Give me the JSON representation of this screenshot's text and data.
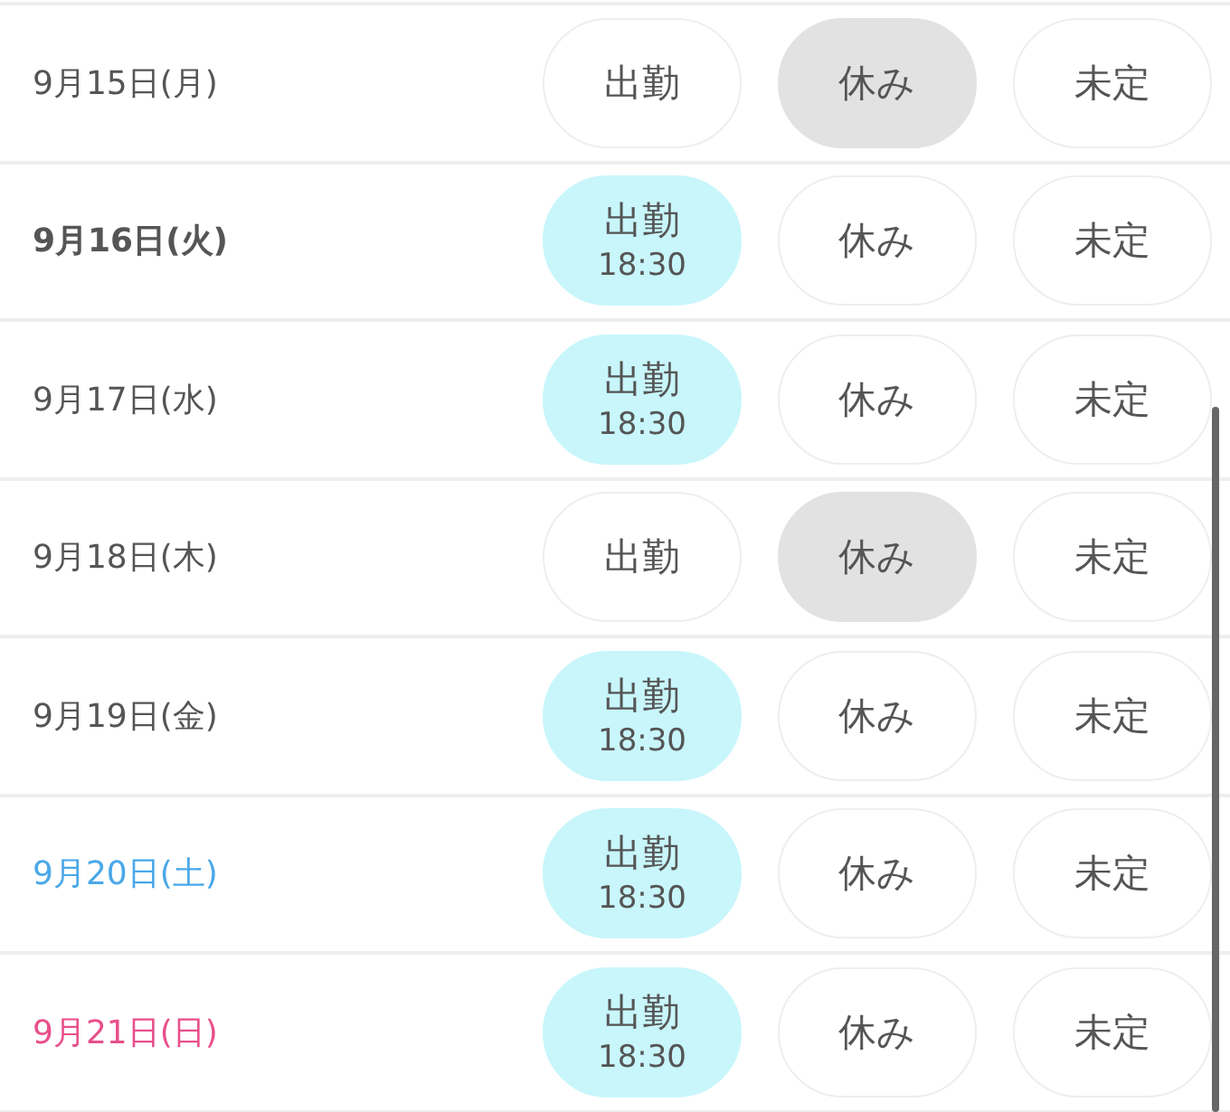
{
  "days": [
    {
      "date": "9月15日(月)",
      "color": "#555555",
      "emphasized": false,
      "options": [
        {
          "label": "出勤",
          "selected": false
        },
        {
          "label": "休み",
          "selected": true
        },
        {
          "label": "未定",
          "selected": false
        }
      ]
    },
    {
      "date": "9月16日(火)",
      "color": "#555555",
      "emphasized": true,
      "options": [
        {
          "label": "出勤",
          "time": "18:30",
          "selected": true
        },
        {
          "label": "休み",
          "selected": false
        },
        {
          "label": "未定",
          "selected": false
        }
      ]
    },
    {
      "date": "9月17日(水)",
      "color": "#555555",
      "emphasized": false,
      "options": [
        {
          "label": "出勤",
          "time": "18:30",
          "selected": true
        },
        {
          "label": "休み",
          "selected": false
        },
        {
          "label": "未定",
          "selected": false
        }
      ]
    },
    {
      "date": "9月18日(木)",
      "color": "#555555",
      "emphasized": false,
      "options": [
        {
          "label": "出勤",
          "selected": false
        },
        {
          "label": "休み",
          "selected": true
        },
        {
          "label": "未定",
          "selected": false
        }
      ]
    },
    {
      "date": "9月19日(金)",
      "color": "#555555",
      "emphasized": false,
      "options": [
        {
          "label": "出勤",
          "time": "18:30",
          "selected": true
        },
        {
          "label": "休み",
          "selected": false
        },
        {
          "label": "未定",
          "selected": false
        }
      ]
    },
    {
      "date": "9月20日(土)",
      "color": "#4aa8e8",
      "emphasized": false,
      "options": [
        {
          "label": "出勤",
          "time": "18:30",
          "selected": true
        },
        {
          "label": "休み",
          "selected": false
        },
        {
          "label": "未定",
          "selected": false
        }
      ]
    },
    {
      "date": "9月21日(日)",
      "color": "#e8508a",
      "emphasized": false,
      "options": [
        {
          "label": "出勤",
          "time": "18:30",
          "selected": true
        },
        {
          "label": "休み",
          "selected": false
        },
        {
          "label": "未定",
          "selected": false
        }
      ]
    }
  ]
}
